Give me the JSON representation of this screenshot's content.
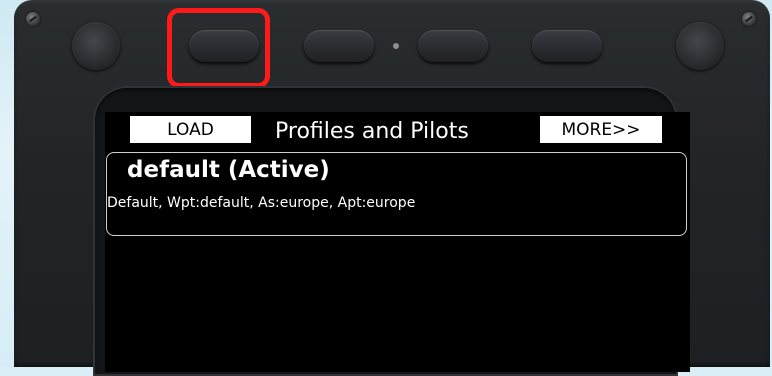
{
  "device": {
    "highlight_color": "#ff1a1a",
    "hardware_buttons": [
      "hw-button-1",
      "hw-button-2",
      "hw-button-3",
      "hw-button-4"
    ]
  },
  "screen": {
    "title": "Profiles and Pilots",
    "load_label": "LOAD",
    "more_label": "MORE>>",
    "profiles": [
      {
        "name": "default (Active)",
        "detail": "Default, Wpt:default, As:europe, Apt:europe"
      }
    ]
  }
}
